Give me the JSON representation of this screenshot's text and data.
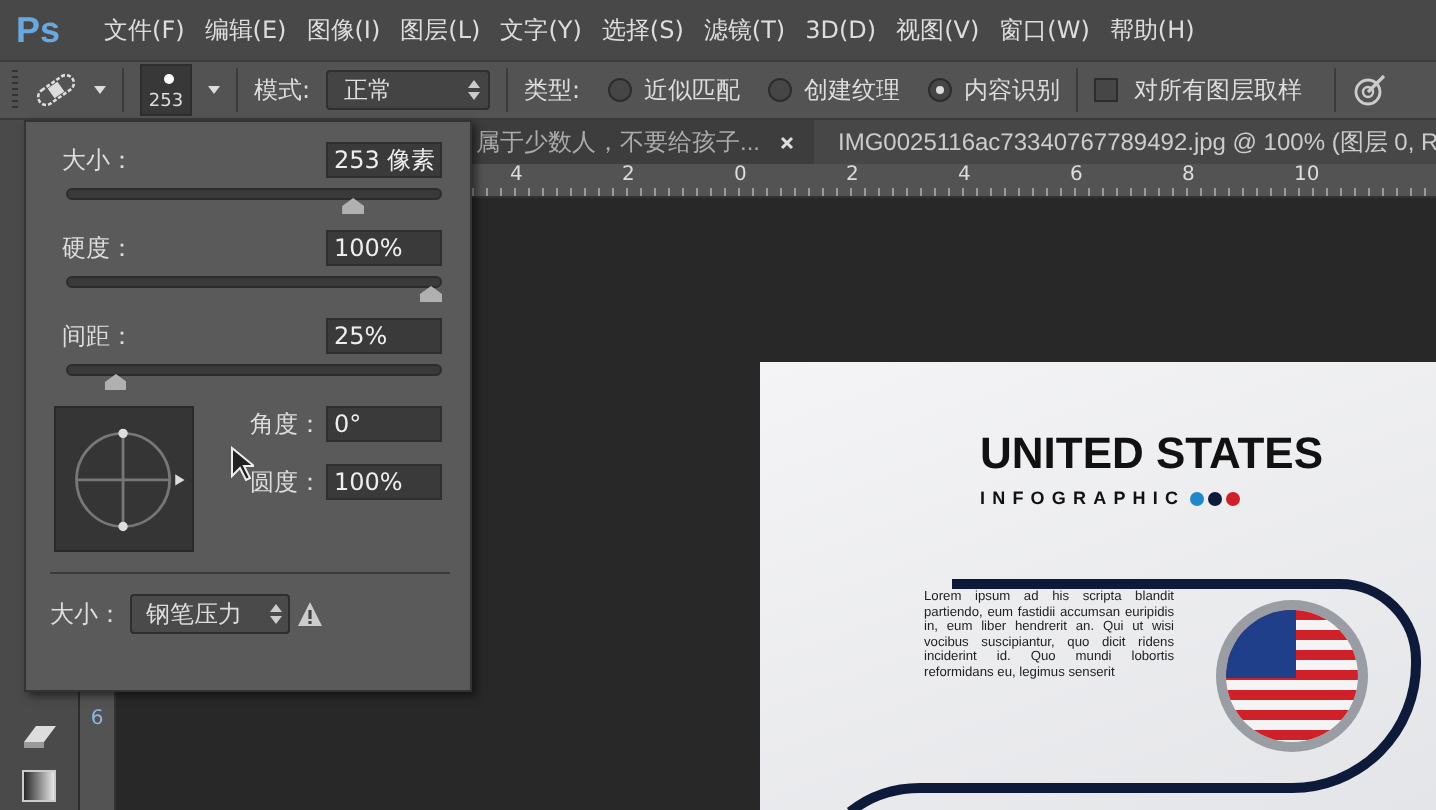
{
  "menu_bar": {
    "logo": "Ps",
    "items": [
      "文件(F)",
      "编辑(E)",
      "图像(I)",
      "图层(L)",
      "文字(Y)",
      "选择(S)",
      "滤镜(T)",
      "3D(D)",
      "视图(V)",
      "窗口(W)",
      "帮助(H)"
    ]
  },
  "options_bar": {
    "brush_size": "253",
    "mode_label": "模式:",
    "mode": "正常",
    "type_label": "类型:",
    "types": [
      {
        "label": "近似匹配",
        "selected": false
      },
      {
        "label": "创建纹理",
        "selected": false
      },
      {
        "label": "内容识别",
        "selected": true
      }
    ],
    "sample_all_layers": {
      "label": "对所有图层取样",
      "checked": false
    }
  },
  "brush_popup": {
    "sliders": [
      {
        "label": "大小：",
        "value": "253 像素",
        "level": 0.78
      },
      {
        "label": "硬度：",
        "value": "100%",
        "level": 1.0
      },
      {
        "label": "间距：",
        "value": "25%",
        "level": 0.11
      }
    ],
    "angle": {
      "label": "角度：",
      "value": "0°"
    },
    "roundness": {
      "label": "圆度：",
      "value": "100%"
    },
    "size_control": {
      "label": "大小：",
      "value": "钢笔压力"
    }
  },
  "document_tabs": [
    {
      "title": "属于少数人，不要给孩子...",
      "selected": false
    },
    {
      "title": "IMG0025116ac73340767789492.jpg @ 100% (图层 0, R",
      "selected": true
    }
  ],
  "rulers": {
    "horizontal": [
      "4",
      "2",
      "0",
      "2",
      "4",
      "6",
      "8",
      "10"
    ],
    "vertical": [
      "6"
    ]
  },
  "canvas": {
    "title": "UNITED STATES",
    "subtitle": "INFOGRAPHIC",
    "dots": [
      {
        "color": "#1e88c8"
      },
      {
        "color": "#0d1a3a"
      },
      {
        "color": "#d0202a"
      }
    ],
    "body": "Lorem ipsum ad his scripta blandit partiendo, eum fastidii accumsan euripidis in, eum liber hendrerit an. Qui ut wisi vocibus suscipiantur, quo dicit ridens inciderint id. Quo mundi lobortis reformidans eu, legimus senserit"
  }
}
